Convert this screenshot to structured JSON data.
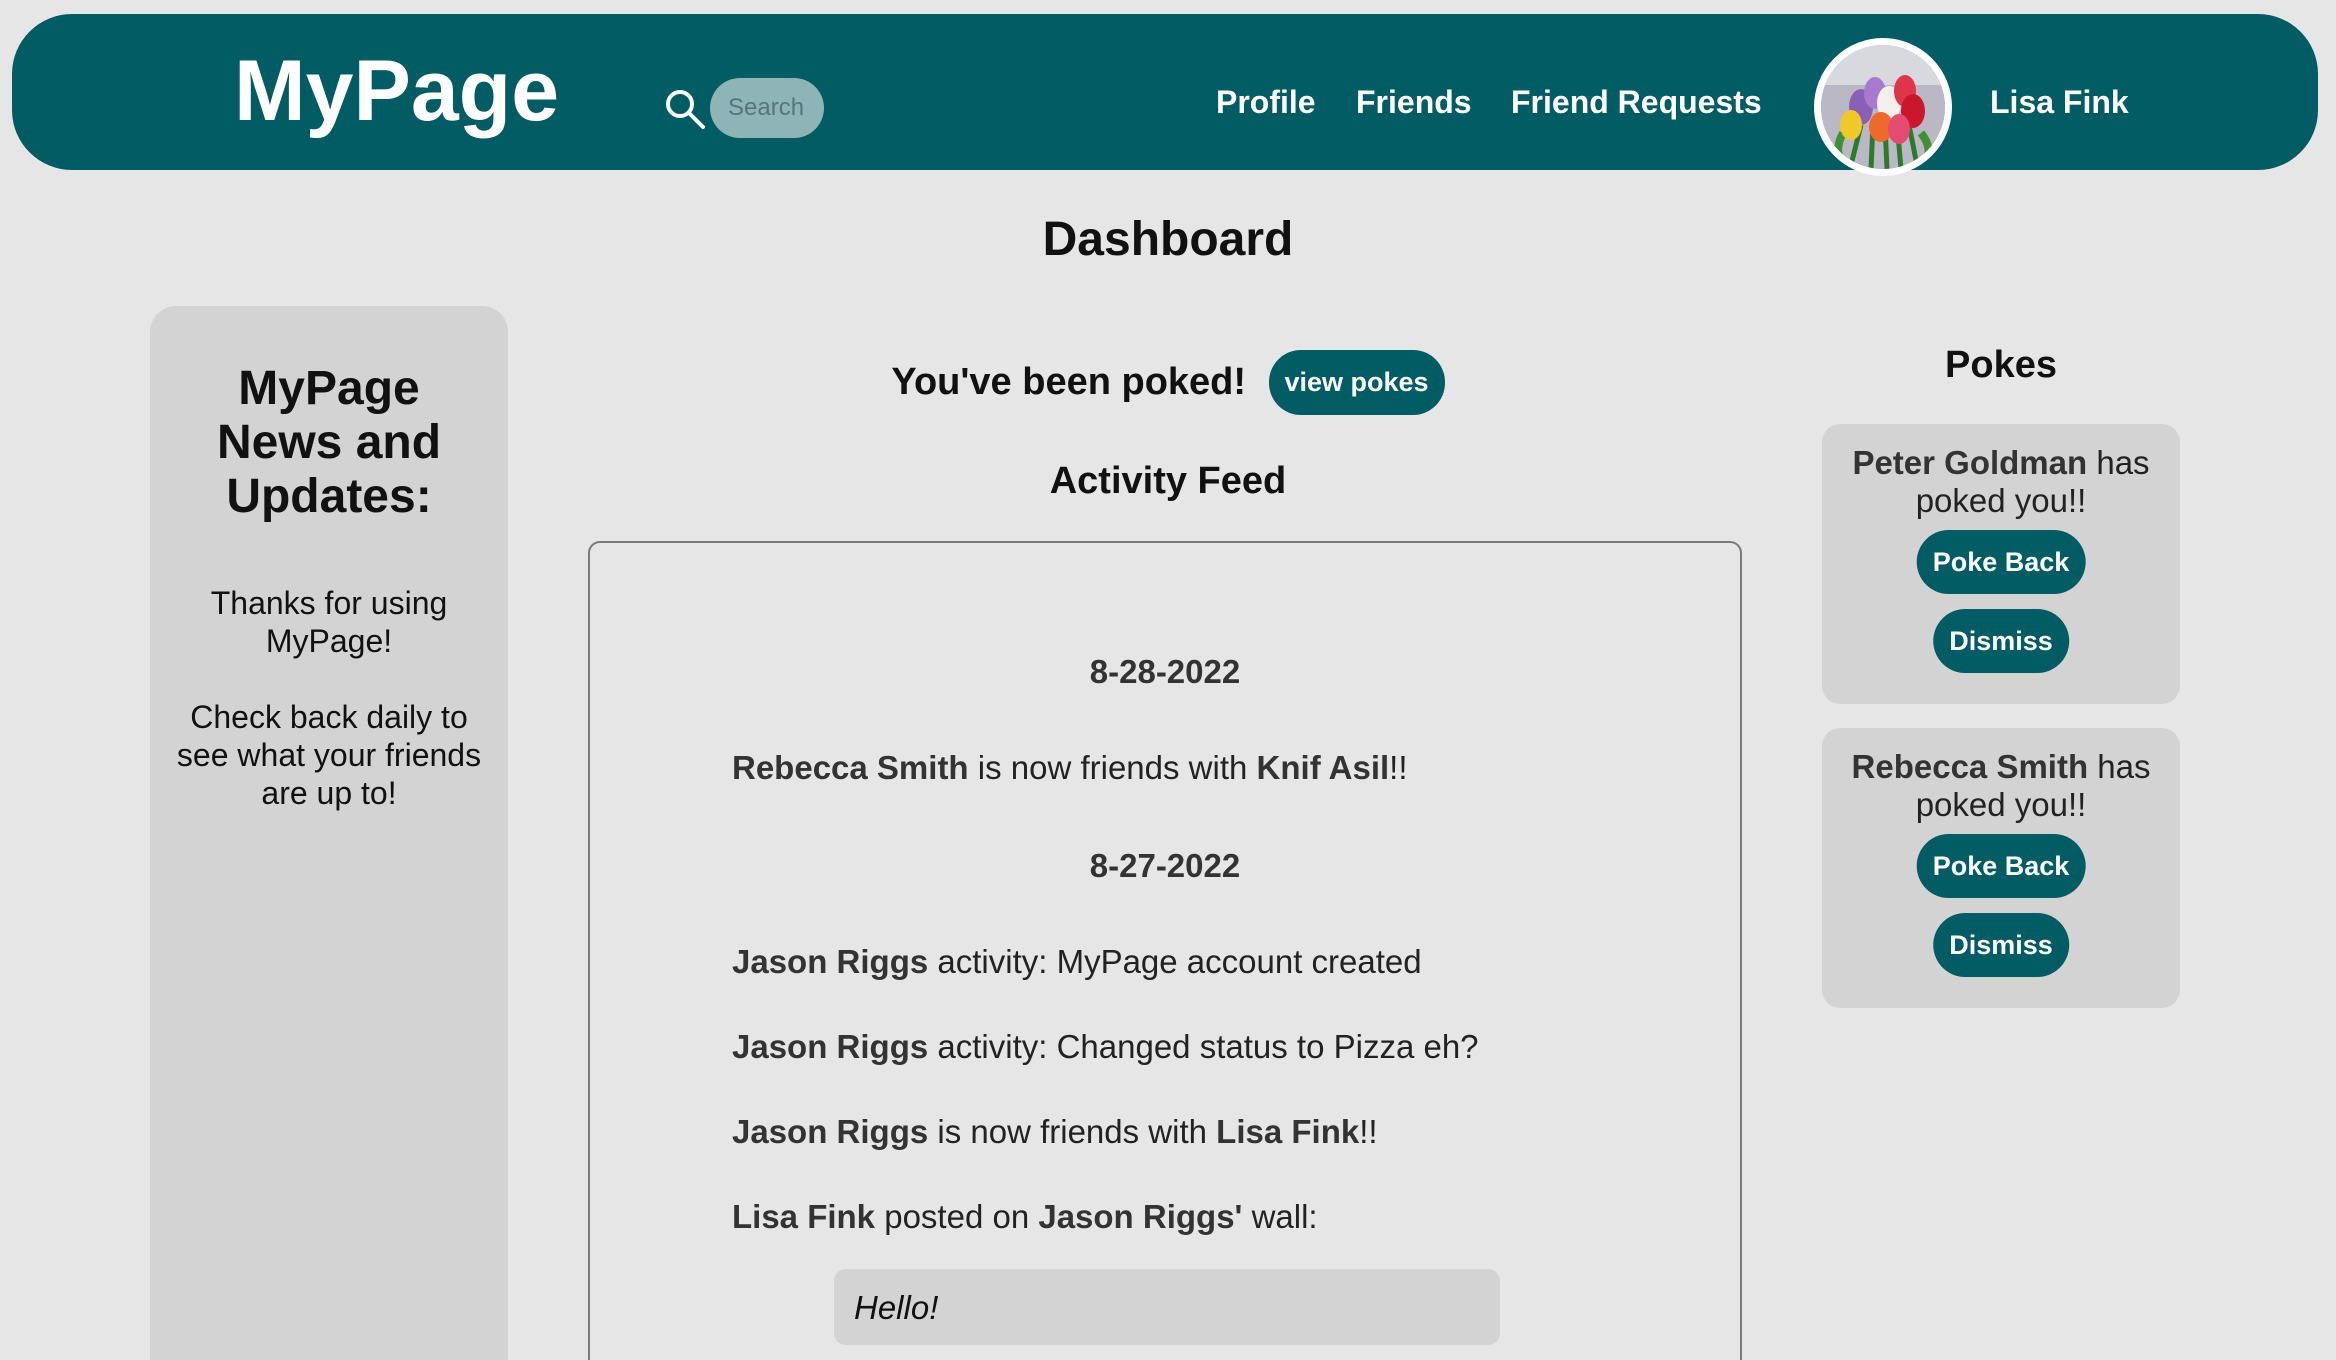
{
  "header": {
    "brand": "MyPage",
    "search": {
      "placeholder": "Search",
      "icon": "search-icon"
    },
    "nav": [
      {
        "label": "Profile"
      },
      {
        "label": "Friends"
      },
      {
        "label": "Friend Requests"
      }
    ],
    "user": {
      "name": "Lisa Fink",
      "avatar": "tulips-avatar"
    },
    "colors": {
      "primary": "#025c64",
      "background": "#e6e6e6",
      "panel": "#d3d3d3"
    }
  },
  "page_title": "Dashboard",
  "news": {
    "title": "MyPage News and Updates:",
    "lines": [
      "Thanks for using MyPage!",
      "Check back daily to see what your friends are up to!"
    ]
  },
  "poke_alert": {
    "text": "You've been poked!",
    "button": "view pokes"
  },
  "feed": {
    "title": "Activity Feed",
    "groups": [
      {
        "date": "8-28-2022",
        "items": [
          {
            "a": "Rebecca Smith",
            "mid": " is now friends with ",
            "b": "Knif Asil",
            "end": "!!"
          }
        ]
      },
      {
        "date": "8-27-2022",
        "items": [
          {
            "a": "Jason Riggs",
            "mid": " activity: MyPage account created",
            "b": "",
            "end": ""
          },
          {
            "a": "Jason Riggs",
            "mid": " activity: Changed status to Pizza eh?",
            "b": "",
            "end": ""
          },
          {
            "a": "Jason Riggs",
            "mid": " is now friends with ",
            "b": "Lisa Fink",
            "end": "!!"
          },
          {
            "a": "Lisa Fink",
            "mid": " posted on ",
            "b": "Jason Riggs'",
            "end": " wall:"
          }
        ]
      }
    ],
    "wall_post": "Hello!"
  },
  "pokes": {
    "title": "Pokes",
    "items": [
      {
        "name": "Peter Goldman",
        "text": " has poked you!!",
        "poke_back": "Poke Back",
        "dismiss": "Dismiss"
      },
      {
        "name": "Rebecca Smith",
        "text": " has poked you!!",
        "poke_back": "Poke Back",
        "dismiss": "Dismiss"
      }
    ]
  }
}
